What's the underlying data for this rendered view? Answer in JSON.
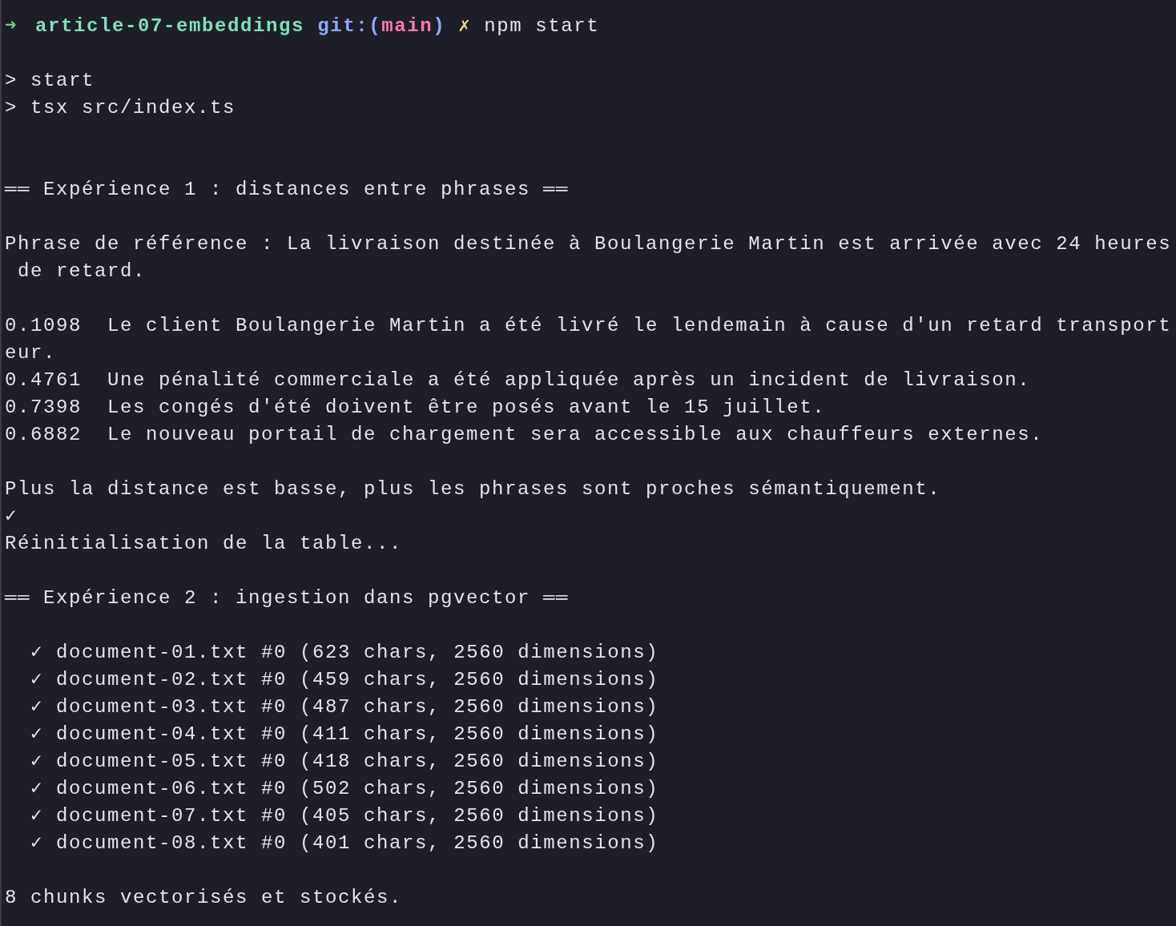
{
  "prompt": {
    "arrow": "➜",
    "directory": "article-07-embeddings",
    "git_label": "git:(",
    "branch": "main",
    "git_close": ")",
    "dirty_mark": "✗",
    "command": "npm start"
  },
  "lines": [
    {
      "kind": "blank"
    },
    {
      "kind": "text",
      "text": "> start"
    },
    {
      "kind": "text",
      "text": "> tsx src/index.ts"
    },
    {
      "kind": "blank"
    },
    {
      "kind": "blank"
    },
    {
      "kind": "heading",
      "text": "══ Expérience 1 : distances entre phrases ══"
    },
    {
      "kind": "blank"
    },
    {
      "kind": "text",
      "text": "Phrase de référence : La livraison destinée à Boulangerie Martin est arrivée avec 24 heures"
    },
    {
      "kind": "text",
      "text": " de retard."
    },
    {
      "kind": "blank"
    },
    {
      "kind": "text",
      "text": "0.1098  Le client Boulangerie Martin a été livré le lendemain à cause d'un retard transport"
    },
    {
      "kind": "text",
      "text": "eur."
    },
    {
      "kind": "text",
      "text": "0.4761  Une pénalité commerciale a été appliquée après un incident de livraison."
    },
    {
      "kind": "text",
      "text": "0.7398  Les congés d'été doivent être posés avant le 15 juillet."
    },
    {
      "kind": "text",
      "text": "0.6882  Le nouveau portail de chargement sera accessible aux chauffeurs externes."
    },
    {
      "kind": "blank"
    },
    {
      "kind": "text",
      "text": "Plus la distance est basse, plus les phrases sont proches sémantiquement."
    },
    {
      "kind": "text",
      "text": "✓"
    },
    {
      "kind": "text",
      "text": "Réinitialisation de la table..."
    },
    {
      "kind": "blank"
    },
    {
      "kind": "heading",
      "text": "══ Expérience 2 : ingestion dans pgvector ══"
    },
    {
      "kind": "blank"
    },
    {
      "kind": "text",
      "text": "  ✓ document-01.txt #0 (623 chars, 2560 dimensions)"
    },
    {
      "kind": "text",
      "text": "  ✓ document-02.txt #0 (459 chars, 2560 dimensions)"
    },
    {
      "kind": "text",
      "text": "  ✓ document-03.txt #0 (487 chars, 2560 dimensions)"
    },
    {
      "kind": "text",
      "text": "  ✓ document-04.txt #0 (411 chars, 2560 dimensions)"
    },
    {
      "kind": "text",
      "text": "  ✓ document-05.txt #0 (418 chars, 2560 dimensions)"
    },
    {
      "kind": "text",
      "text": "  ✓ document-06.txt #0 (502 chars, 2560 dimensions)"
    },
    {
      "kind": "text",
      "text": "  ✓ document-07.txt #0 (405 chars, 2560 dimensions)"
    },
    {
      "kind": "text",
      "text": "  ✓ document-08.txt #0 (401 chars, 2560 dimensions)"
    },
    {
      "kind": "blank"
    },
    {
      "kind": "text",
      "text": "8 chunks vectorisés et stockés."
    }
  ]
}
